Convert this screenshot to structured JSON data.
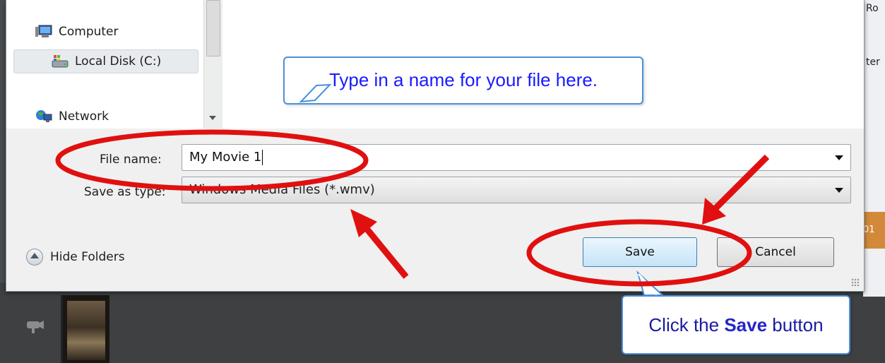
{
  "nav": {
    "computer": "Computer",
    "local_disk": "Local Disk (C:)",
    "network": "Network"
  },
  "form": {
    "file_name_label": "File name:",
    "file_name_value": "My Movie 1",
    "save_type_label": "Save as type:",
    "save_type_value": "Windows Media Files (*.wmv)"
  },
  "buttons": {
    "hide_folders": "Hide Folders",
    "save": "Save",
    "cancel": "Cancel"
  },
  "callouts": {
    "filename_tip": "Type in a name for your file here.",
    "save_tip_prefix": "Click the ",
    "save_tip_bold": "Save",
    "save_tip_suffix": " button"
  },
  "background": {
    "right_text_1": "Ro",
    "right_text_2": "ter",
    "right_strip": "01"
  },
  "colors": {
    "annotation_red": "#e01010",
    "callout_border": "#4a90d9",
    "callout_text": "#1a1aff",
    "save_button_border": "#3c7fb1"
  }
}
